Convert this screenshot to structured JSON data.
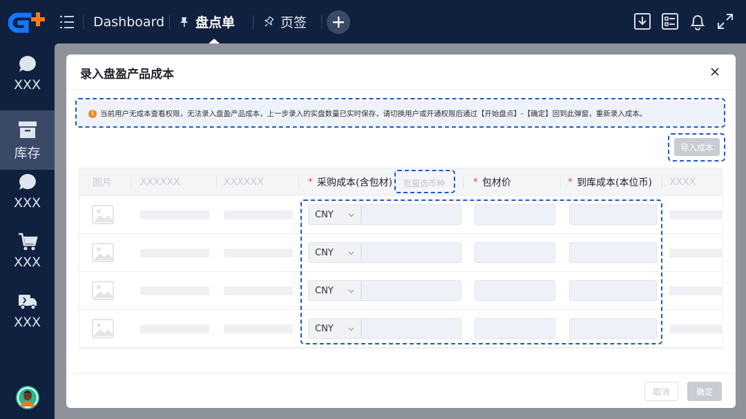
{
  "topbar": {
    "tabs": [
      {
        "label": "Dashboard"
      },
      {
        "label": "盘点单"
      },
      {
        "label": "页签"
      }
    ]
  },
  "sidebar": {
    "items": [
      {
        "label": "XXX",
        "icon": "chat-bubble-icon"
      },
      {
        "label": "库存",
        "icon": "archive-box-icon"
      },
      {
        "label": "XXX",
        "icon": "chat-bubble-icon"
      },
      {
        "label": "XXX",
        "icon": "shopping-cart-icon"
      },
      {
        "label": "XXX",
        "icon": "delivery-truck-icon"
      }
    ]
  },
  "modal": {
    "title": "录入盘盈产品成本",
    "alert": "当前用户无成本查看权限，无法录入盘盈产品成本，上一步录入的实盘数量已实时保存，请切换用户或开通权限后通过【开始盘点】-【确定】回到此弹窗，重新录入成本。",
    "import_label": "导入成本",
    "columns": {
      "image": "图片",
      "col2": "XXXXXX",
      "col3": "XXXXXX",
      "purchase_cost": "采购成本(含包材)",
      "batch_currency": "批量选币种",
      "packaging": "包材价",
      "landed_cost": "到库成本(本位币)",
      "col7": "XXXX"
    },
    "rows": [
      {
        "currency": "CNY"
      },
      {
        "currency": "CNY"
      },
      {
        "currency": "CNY"
      },
      {
        "currency": "CNY"
      }
    ],
    "cancel_label": "取消",
    "confirm_label": "确定"
  },
  "colors": {
    "nav_bg": "#10213f",
    "nav_active": "#3a4967",
    "accent_dash": "#1a57c9",
    "logo_blue": "#1677ff",
    "logo_orange": "#ff7a1a",
    "required": "#e5484d"
  }
}
